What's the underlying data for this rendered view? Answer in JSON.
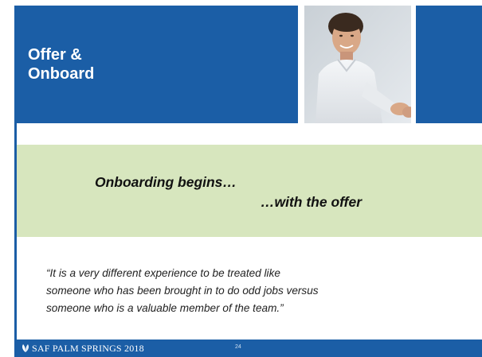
{
  "slide": {
    "title": "Offer &\nOnboard",
    "band": {
      "line1": "Onboarding begins…",
      "line2": "…with the offer"
    },
    "quote": "“It is a very different experience to be treated like\nsomeone who has been brought in to do odd jobs versus\nsomeone who is a valuable member of the team.”",
    "footer": {
      "brand": "SAF PALM SPRINGS 2018",
      "page_number": "24"
    }
  },
  "colors": {
    "header_blue": "#1b5ea6",
    "band_green": "#d7e6be",
    "text_dark": "#111111"
  },
  "icons": {
    "logo": "leaf-emblem-icon",
    "photo": "businessman-handshake-photo"
  }
}
